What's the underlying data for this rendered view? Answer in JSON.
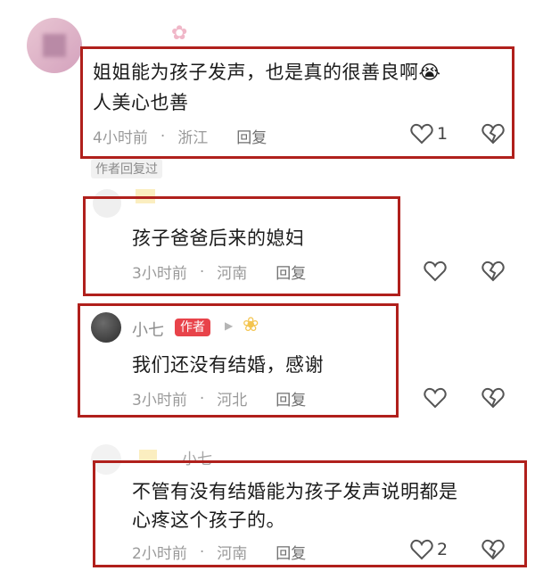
{
  "comments": [
    {
      "text_line1": "姐姐能为孩子发声，也是真的很善良啊😭",
      "text_line2": "人美心也善",
      "time": "4小时前",
      "location": "浙江",
      "reply": "回复",
      "likes": "1",
      "author_replied": "作者回复过"
    },
    {
      "text_line1": "孩子爸爸后来的媳妇",
      "time": "3小时前",
      "location": "河南",
      "reply": "回复"
    },
    {
      "user": "小七",
      "badge": "作者",
      "text_line1": "我们还没有结婚，感谢",
      "time": "3小时前",
      "location": "河北",
      "reply": "回复"
    },
    {
      "user": "小七",
      "text_line1": "不管有没有结婚能为孩子发声说明都是",
      "text_line2": "心疼这个孩子的。",
      "time": "2小时前",
      "location": "河南",
      "reply": "回复",
      "likes": "2"
    }
  ],
  "colors": {
    "highlight_box": "#b0201c",
    "author_badge": "#e8434a"
  }
}
